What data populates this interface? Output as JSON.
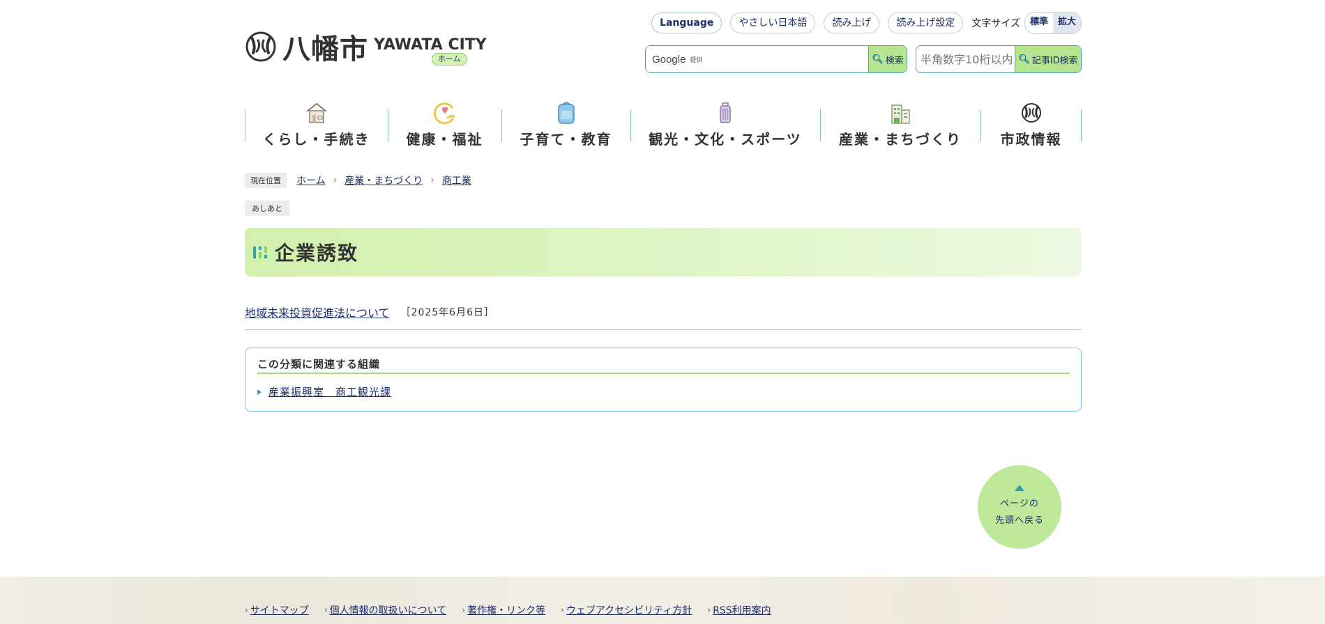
{
  "header": {
    "logo_jp": "八幡市",
    "logo_en": "YAWATA CITY",
    "home_badge": "ホーム",
    "language": "Language",
    "easy_japanese": "やさしい日本語",
    "read_aloud": "読み上げ",
    "read_aloud_settings": "読み上げ設定",
    "font_size_label": "文字サイズ",
    "font_size_standard": "標準",
    "font_size_large": "拡大",
    "google_brand": "Google",
    "google_provided": "提供",
    "search_button": "検索",
    "article_id_placeholder": "半角数字10桁以内",
    "article_id_button": "記事ID検索"
  },
  "nav": [
    {
      "label": "くらし・手続き",
      "icon": "house-icon"
    },
    {
      "label": "健康・福祉",
      "icon": "heart-hand-icon"
    },
    {
      "label": "子育て・教育",
      "icon": "school-bag-icon"
    },
    {
      "label": "観光・文化・スポーツ",
      "icon": "suitcase-icon"
    },
    {
      "label": "産業・まちづくり",
      "icon": "buildings-icon"
    },
    {
      "label": "市政情報",
      "icon": "city-emblem-icon"
    }
  ],
  "breadcrumb": {
    "current_label": "現在位置",
    "items": [
      "ホーム",
      "産業・まちづくり",
      "商工業"
    ]
  },
  "ashiato": "あしあと",
  "page_title": "企業誘致",
  "articles": [
    {
      "title": "地域未来投資促進法について",
      "date": "［2025年6月6日］"
    }
  ],
  "related_org": {
    "title": "この分類に関連する組織",
    "link": "産業振興室　商工観光課"
  },
  "page_top": {
    "line1": "ページの",
    "line2": "先頭へ戻る"
  },
  "footer_links": [
    "サイトマップ",
    "個人情報の取扱いについて",
    "著作権・リンク等",
    "ウェブアクセシビリティ方針",
    "RSS利用案内"
  ],
  "colors": {
    "accent_green": "#b7e48f",
    "border_teal": "#4aa3a8",
    "link_navy": "#1d2f6b"
  }
}
